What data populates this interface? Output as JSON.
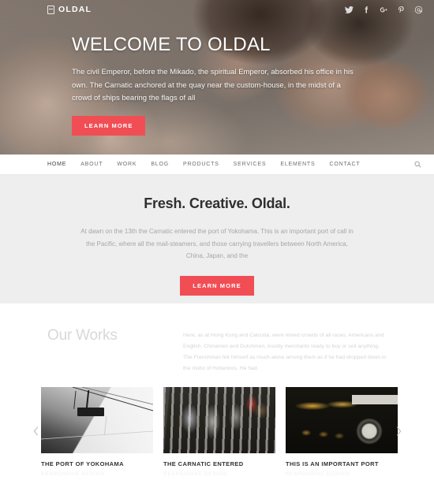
{
  "topbar": {
    "brand": "OLDAL",
    "brand_icon": "book-logo-icon",
    "socials": [
      {
        "name": "twitter-icon",
        "label": "Twitter"
      },
      {
        "name": "facebook-icon",
        "label": "Facebook"
      },
      {
        "name": "google-plus-icon",
        "label": "Google Plus"
      },
      {
        "name": "pinterest-icon",
        "label": "Pinterest"
      },
      {
        "name": "instagram-icon",
        "label": "Instagram"
      }
    ]
  },
  "hero": {
    "title": "WELCOME TO OLDAL",
    "subtitle": "The civil Emperor, before the Mikado, the spiritual Emperor, absorbed his office in his own. The Carnatic anchored at the quay near the custom-house, in the midst of a crowd of ships bearing the flags of all",
    "button": "LEARN MORE",
    "button_color": "#f04e54"
  },
  "nav": {
    "items": [
      {
        "label": "HOME",
        "active": true
      },
      {
        "label": "ABOUT",
        "active": false
      },
      {
        "label": "WORK",
        "active": false
      },
      {
        "label": "BLOG",
        "active": false
      },
      {
        "label": "PRODUCTS",
        "active": false
      },
      {
        "label": "SERVICES",
        "active": false
      },
      {
        "label": "ELEMENTS",
        "active": false
      },
      {
        "label": "CONTACT",
        "active": false
      }
    ],
    "search_icon": "search-icon"
  },
  "intro": {
    "title": "Fresh. Creative. Oldal.",
    "text": "At dawn on the 13th the Carnatic entered the port of Yokohama. This is an important port of call in the Pacific, where all the mail-steamers, and those carrying travellers between North America, China, Japan, and the",
    "button": "LEARN MORE",
    "background": "#eeeeee"
  },
  "works": {
    "title": "Our Works",
    "text": "Here, as at Hong Kong and Calcutta, were mixed crowds of all races, Americans and English, Chinamen and Dutchmen, mostly merchants ready to buy or sell anything. The Frenchman felt himself as much alone among them as if he had dropped down in the midst of Hottentots. He had.",
    "prev_icon": "chevron-left-icon",
    "next_icon": "chevron-right-icon",
    "cards": [
      {
        "title": "THE PORT OF YOKOHAMA",
        "category": "RESPONSIVE DESIGN",
        "image": "cable-car-photo"
      },
      {
        "title": "THE CARNATIC ENTERED",
        "category": "RESPONSIVE DESIGN",
        "image": "hanging-ropes-photo"
      },
      {
        "title": "THIS IS AN IMPORTANT PORT",
        "category": "RESPONSIVE DESIGN",
        "image": "vintage-camera-photo"
      }
    ]
  }
}
